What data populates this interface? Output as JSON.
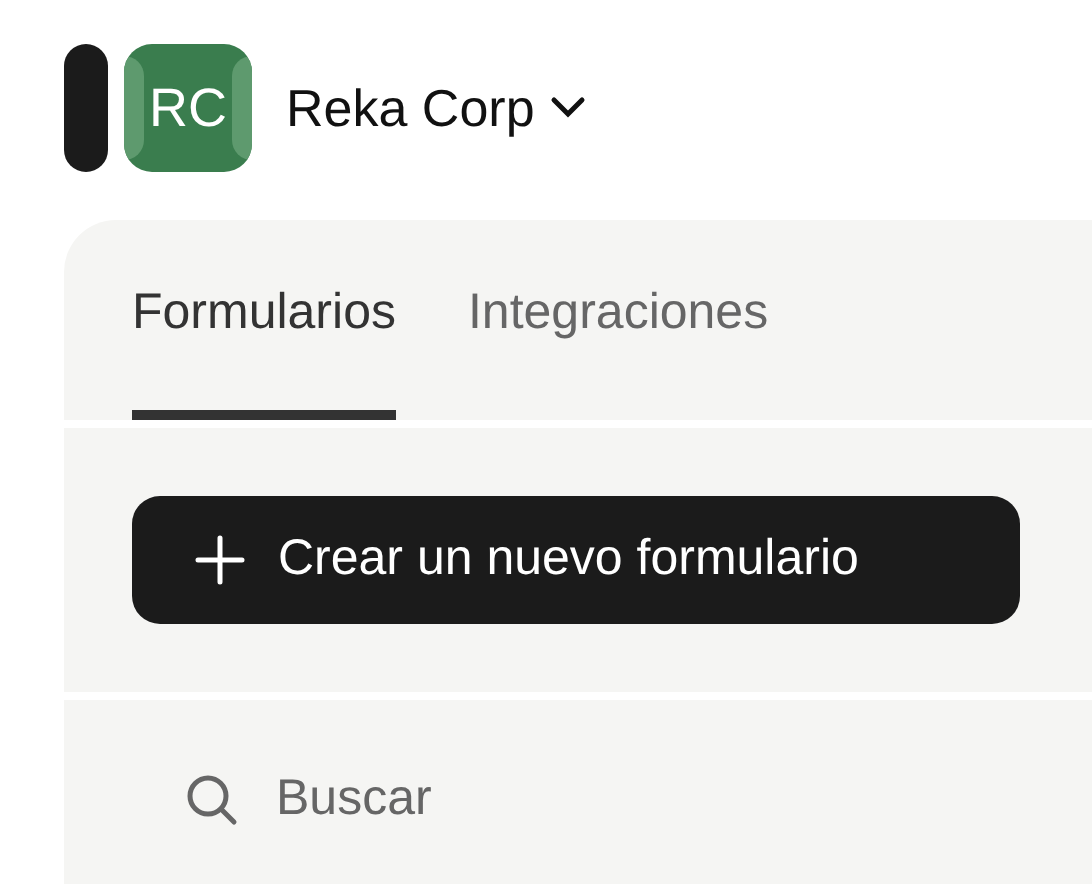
{
  "workspace": {
    "initials": "RC",
    "name": "Reka Corp"
  },
  "tabs": [
    {
      "label": "Formularios",
      "selected": true
    },
    {
      "label": "Integraciones",
      "selected": false
    }
  ],
  "create_button": {
    "label": "Crear un nuevo formulario"
  },
  "search": {
    "placeholder": "Buscar"
  }
}
